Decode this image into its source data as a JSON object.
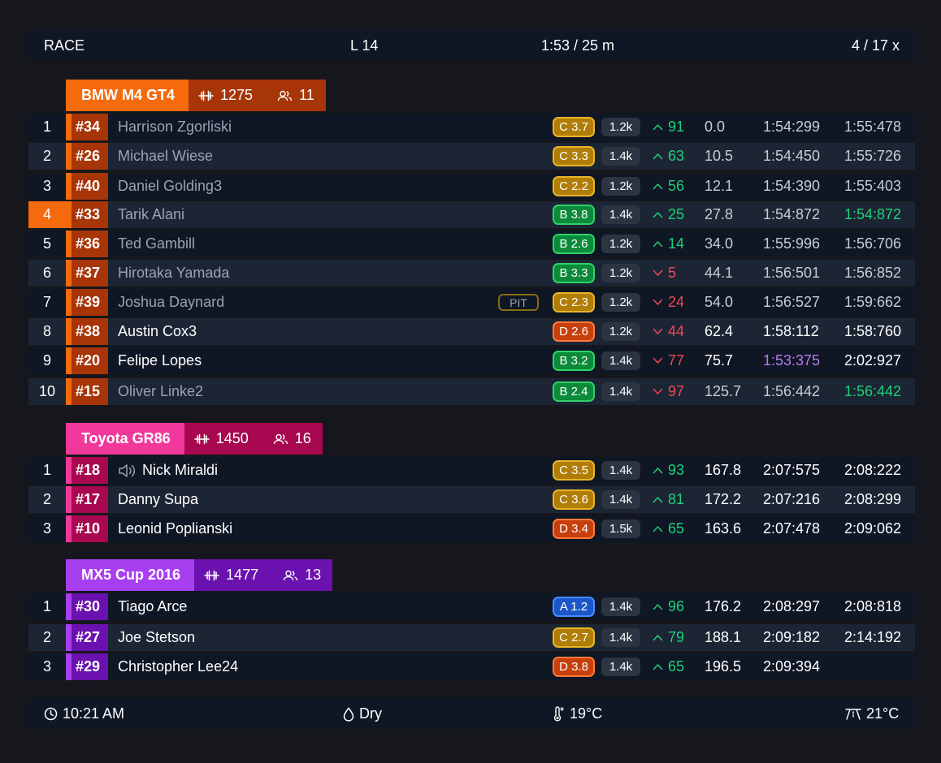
{
  "topbar": {
    "session": "RACE",
    "lap": "L 14",
    "time": "1:53 / 25 m",
    "incidents": "4 / 17 x"
  },
  "classes": [
    {
      "name": "BMW M4 GT4",
      "sof": "1275",
      "count": "11",
      "colors": {
        "name_bg": "#f46a0c",
        "stats_bg": "#a83508",
        "stripe": "#f46a0c",
        "num_bg": "#a83508"
      },
      "rows": [
        {
          "pos": "1",
          "num": "#34",
          "driver": "Harrison Zgorliski",
          "lic": "C 3.7",
          "lic_class": "C",
          "ir": "1.2k",
          "delta": "91",
          "dir": "up",
          "gap": "0.0",
          "best": "1:54:299",
          "last": "1:55:478"
        },
        {
          "pos": "2",
          "num": "#26",
          "driver": "Michael Wiese",
          "lic": "C 3.3",
          "lic_class": "C",
          "ir": "1.4k",
          "delta": "63",
          "dir": "up",
          "gap": "10.5",
          "best": "1:54:450",
          "last": "1:55:726"
        },
        {
          "pos": "3",
          "num": "#40",
          "driver": "Daniel Golding3",
          "lic": "C 2.2",
          "lic_class": "C",
          "ir": "1.2k",
          "delta": "56",
          "dir": "up",
          "gap": "12.1",
          "best": "1:54:390",
          "last": "1:55:403"
        },
        {
          "pos": "4",
          "num": "#33",
          "driver": "Tarik Alani",
          "lic": "B 3.8",
          "lic_class": "B",
          "ir": "1.4k",
          "delta": "25",
          "dir": "up",
          "gap": "27.8",
          "best": "1:54:872",
          "last": "1:54:872",
          "highlight": true,
          "last_color": "green"
        },
        {
          "pos": "5",
          "num": "#36",
          "driver": "Ted Gambill",
          "lic": "B 2.6",
          "lic_class": "B",
          "ir": "1.2k",
          "delta": "14",
          "dir": "up",
          "gap": "34.0",
          "best": "1:55:996",
          "last": "1:56:706"
        },
        {
          "pos": "6",
          "num": "#37",
          "driver": "Hirotaka Yamada",
          "lic": "B 3.3",
          "lic_class": "B",
          "ir": "1.2k",
          "delta": "5",
          "dir": "down",
          "gap": "44.1",
          "best": "1:56:501",
          "last": "1:56:852"
        },
        {
          "pos": "7",
          "num": "#39",
          "driver": "Joshua Daynard",
          "pit": "PIT",
          "lic": "C 2.3",
          "lic_class": "C",
          "ir": "1.2k",
          "delta": "24",
          "dir": "down",
          "gap": "54.0",
          "best": "1:56:527",
          "last": "1:59:662"
        },
        {
          "pos": "8",
          "num": "#38",
          "driver": "Austin Cox3",
          "lic": "D 2.6",
          "lic_class": "D",
          "ir": "1.2k",
          "delta": "44",
          "dir": "down",
          "gap": "62.4",
          "best": "1:58:112",
          "last": "1:58:760",
          "bright": true
        },
        {
          "pos": "9",
          "num": "#20",
          "driver": "Felipe Lopes",
          "lic": "B 3.2",
          "lic_class": "B",
          "ir": "1.4k",
          "delta": "77",
          "dir": "down",
          "gap": "75.7",
          "best": "1:53:375",
          "last": "2:02:927",
          "bright": true,
          "best_color": "purple"
        },
        {
          "pos": "10",
          "num": "#15",
          "driver": "Oliver Linke2",
          "lic": "B 2.4",
          "lic_class": "B",
          "ir": "1.4k",
          "delta": "97",
          "dir": "down",
          "gap": "125.7",
          "best": "1:56:442",
          "last": "1:56:442",
          "last_color": "green"
        }
      ]
    },
    {
      "name": "Toyota GR86",
      "sof": "1450",
      "count": "16",
      "colors": {
        "name_bg": "#f0399a",
        "stats_bg": "#a8084f",
        "stripe": "#f0399a",
        "num_bg": "#a8084f"
      },
      "rows": [
        {
          "pos": "1",
          "num": "#18",
          "driver": "Nick Miraldi",
          "speaker": true,
          "lic": "C 3.5",
          "lic_class": "C",
          "ir": "1.4k",
          "delta": "93",
          "dir": "up",
          "gap": "167.8",
          "best": "2:07:575",
          "last": "2:08:222",
          "bright": true
        },
        {
          "pos": "2",
          "num": "#17",
          "driver": "Danny Supa",
          "lic": "C 3.6",
          "lic_class": "C",
          "ir": "1.4k",
          "delta": "81",
          "dir": "up",
          "gap": "172.2",
          "best": "2:07:216",
          "last": "2:08:299",
          "bright": true
        },
        {
          "pos": "3",
          "num": "#10",
          "driver": "Leonid Poplianski",
          "lic": "D 3.4",
          "lic_class": "D",
          "ir": "1.5k",
          "delta": "65",
          "dir": "up",
          "gap": "163.6",
          "best": "2:07:478",
          "last": "2:09:062",
          "bright": true
        }
      ]
    },
    {
      "name": "MX5 Cup 2016",
      "sof": "1477",
      "count": "13",
      "colors": {
        "name_bg": "#a73ff0",
        "stats_bg": "#6a11b0",
        "stripe": "#a73ff0",
        "num_bg": "#6a11b0"
      },
      "rows": [
        {
          "pos": "1",
          "num": "#30",
          "driver": "Tiago Arce",
          "lic": "A 1.2",
          "lic_class": "A",
          "ir": "1.4k",
          "delta": "96",
          "dir": "up",
          "gap": "176.2",
          "best": "2:08:297",
          "last": "2:08:818",
          "bright": true
        },
        {
          "pos": "2",
          "num": "#27",
          "driver": "Joe Stetson",
          "lic": "C 2.7",
          "lic_class": "C",
          "ir": "1.4k",
          "delta": "79",
          "dir": "up",
          "gap": "188.1",
          "best": "2:09:182",
          "last": "2:14:192",
          "bright": true
        },
        {
          "pos": "3",
          "num": "#29",
          "driver": "Christopher Lee24",
          "lic": "D 3.8",
          "lic_class": "D",
          "ir": "1.4k",
          "delta": "65",
          "dir": "up",
          "gap": "196.5",
          "best": "2:09:394",
          "last": "",
          "bright": true
        }
      ]
    }
  ],
  "bottombar": {
    "clock_icon": "clock-icon",
    "time": "10:21 AM",
    "weather_icon": "droplet-icon",
    "weather": "Dry",
    "air_icon": "thermometer-icon",
    "air_temp": "19°C",
    "track_icon": "track-temp-icon",
    "track_temp": "21°C"
  }
}
